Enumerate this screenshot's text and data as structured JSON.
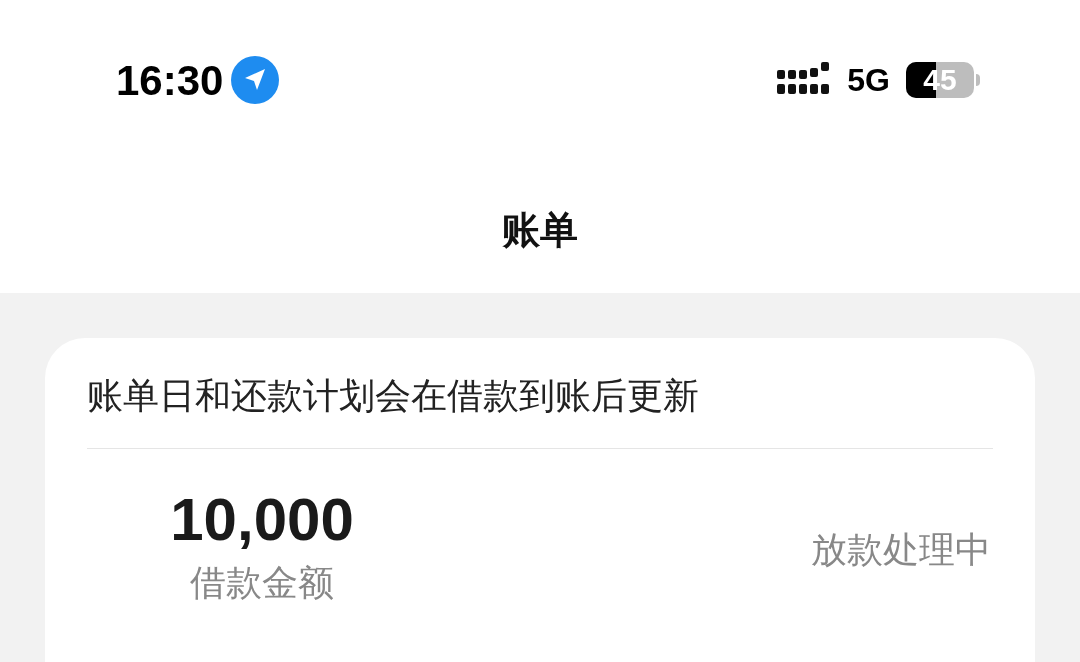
{
  "status_bar": {
    "time": "16:30",
    "network": "5G",
    "battery": "45"
  },
  "header": {
    "title": "账单"
  },
  "card": {
    "notice": "账单日和还款计划会在借款到账后更新",
    "amount": "10,000",
    "amount_label": "借款金额",
    "status": "放款处理中"
  }
}
